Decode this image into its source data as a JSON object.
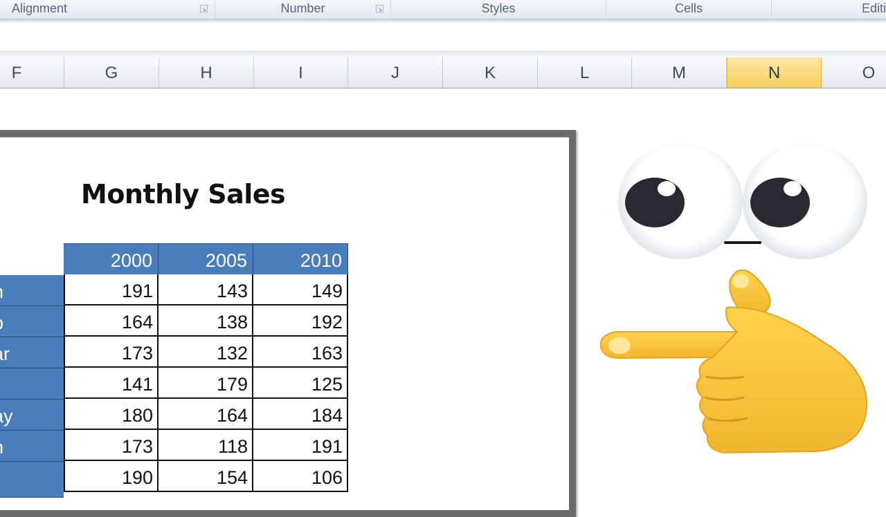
{
  "ribbon": {
    "groups": [
      "Alignment",
      "Number",
      "Styles",
      "Cells",
      "Editi"
    ]
  },
  "columns": [
    "F",
    "G",
    "H",
    "I",
    "J",
    "K",
    "L",
    "M",
    "N",
    "O"
  ],
  "selected_column": "N",
  "sheet": {
    "title": "Monthly Sales",
    "year_headers": [
      "2000",
      "2005",
      "2010"
    ],
    "rows": [
      {
        "label": "n",
        "values": [
          "191",
          "143",
          "149"
        ]
      },
      {
        "label": "b",
        "values": [
          "164",
          "138",
          "192"
        ]
      },
      {
        "label": "ar",
        "values": [
          "173",
          "132",
          "163"
        ]
      },
      {
        "label": "r",
        "values": [
          "141",
          "179",
          "125"
        ]
      },
      {
        "label": "ay",
        "values": [
          "180",
          "164",
          "184"
        ]
      },
      {
        "label": "n",
        "values": [
          "173",
          "118",
          "191"
        ]
      },
      {
        "label": "",
        "values": [
          "190",
          "154",
          "106"
        ]
      }
    ]
  },
  "colors": {
    "header_fill": "#4a7ebb",
    "selected_column_fill": "#f7cf5e",
    "emoji_yellow": "#f6c23e",
    "pupil": "#2b2833"
  },
  "icons": [
    "dialog-launcher-icon",
    "googly-eyes-icon",
    "pointing-hand-icon"
  ]
}
